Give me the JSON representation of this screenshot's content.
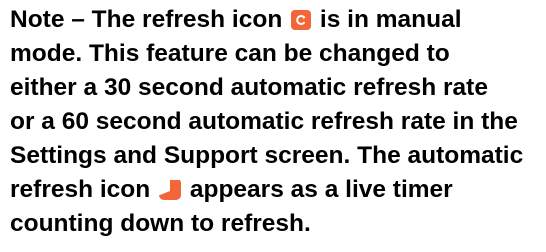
{
  "note": {
    "line1_before_icon": "Note – The refresh icon ",
    "line1_after_icon": " is in manual",
    "line2": "mode. This feature can be changed to",
    "line3": "either a 30 second automatic refresh rate",
    "line4": "or a 60 second automatic refresh rate in the",
    "line5": "Settings and Support screen. The automatic",
    "line6_before_icon": "refresh icon ",
    "line6_after_icon": " appears as a live timer",
    "line7": "counting down to refresh."
  },
  "icons": {
    "manual_refresh": "refresh-icon",
    "auto_refresh_timer": "timer-icon"
  },
  "colors": {
    "accent": "#F2663A",
    "icon_glyph": "#ffffff"
  }
}
